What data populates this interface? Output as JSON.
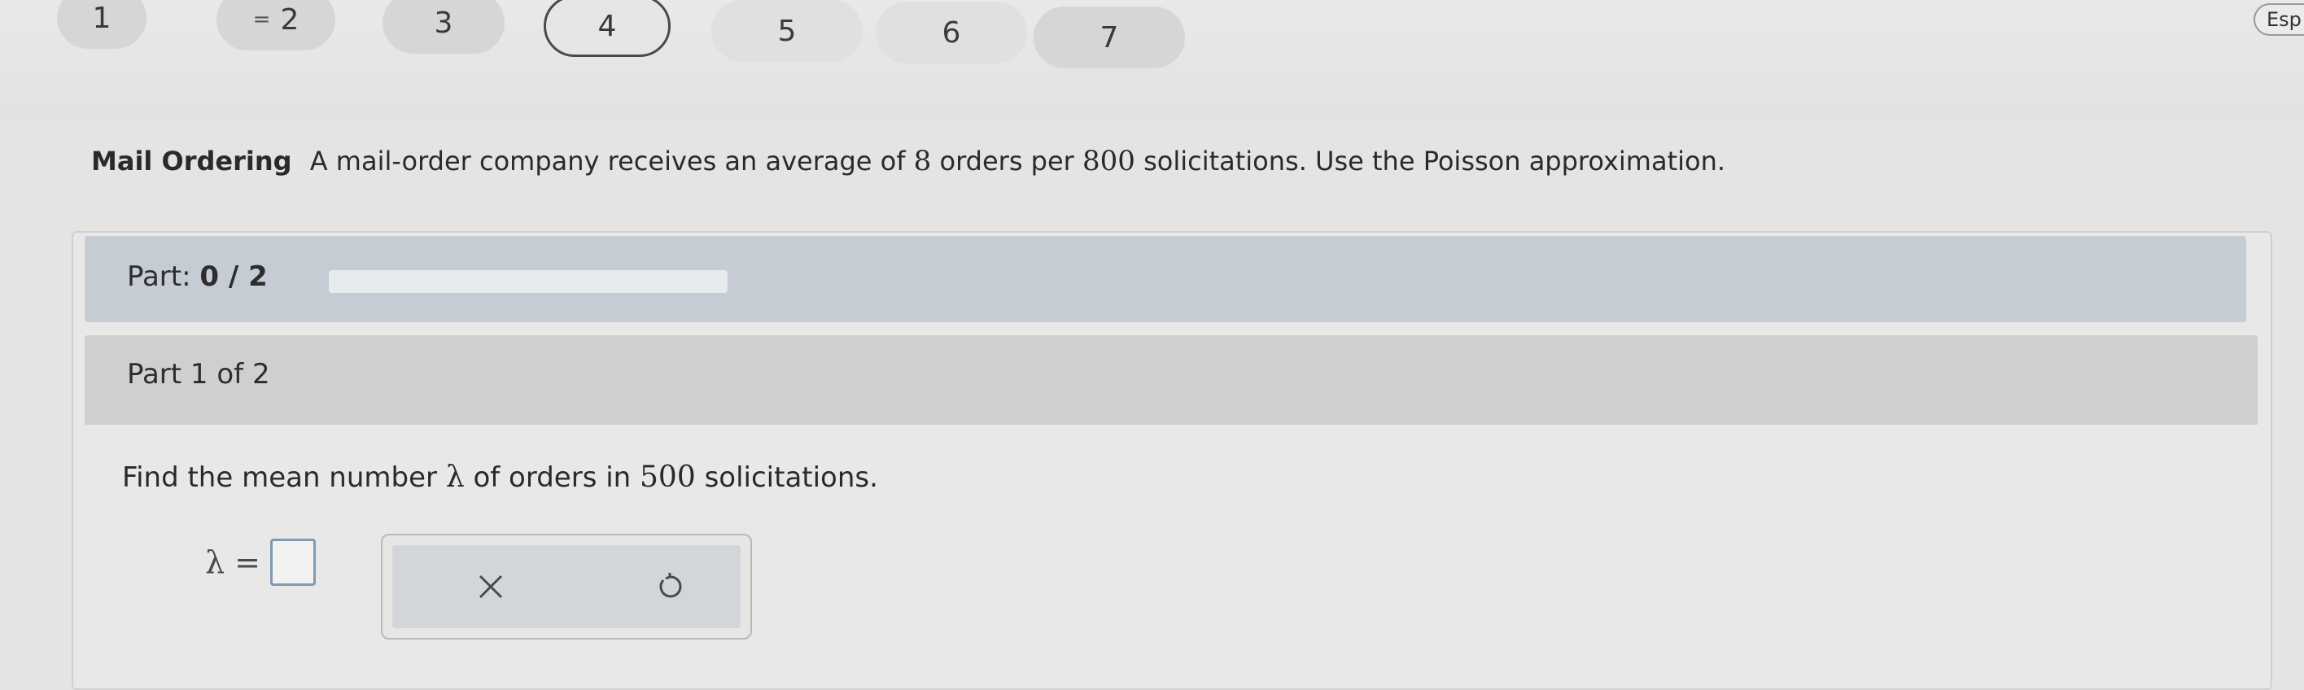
{
  "question_nav": {
    "items": [
      {
        "label": "1"
      },
      {
        "label": "2",
        "marker": "="
      },
      {
        "label": "3"
      },
      {
        "label": "4"
      },
      {
        "label": "5"
      },
      {
        "label": "6"
      },
      {
        "label": "7"
      }
    ]
  },
  "language_button": {
    "label": "Esp"
  },
  "problem": {
    "topic": "Mail Ordering",
    "text_1": "A mail-order company receives an average of",
    "orders": "8",
    "text_2": "orders per",
    "solicitations": "800",
    "text_3": "solicitations. Use the Poisson approximation."
  },
  "progress": {
    "prefix": "Part:",
    "value_text": "0 / 2",
    "completed": 0,
    "total": 2
  },
  "part_header": {
    "label": "Part 1 of 2"
  },
  "question": {
    "text_1": "Find the mean number",
    "symbol": "λ",
    "text_2": "of orders in",
    "count": "500",
    "text_3": "solicitations."
  },
  "answer": {
    "variable": "λ",
    "equals": "=",
    "value": ""
  },
  "tools": {
    "clear_icon": "close-icon",
    "reset_icon": "undo-icon"
  },
  "colors": {
    "progress_bar": "#c5ccd4",
    "part_header": "#cfcfcd",
    "answer_border": "#7c9bb8"
  }
}
